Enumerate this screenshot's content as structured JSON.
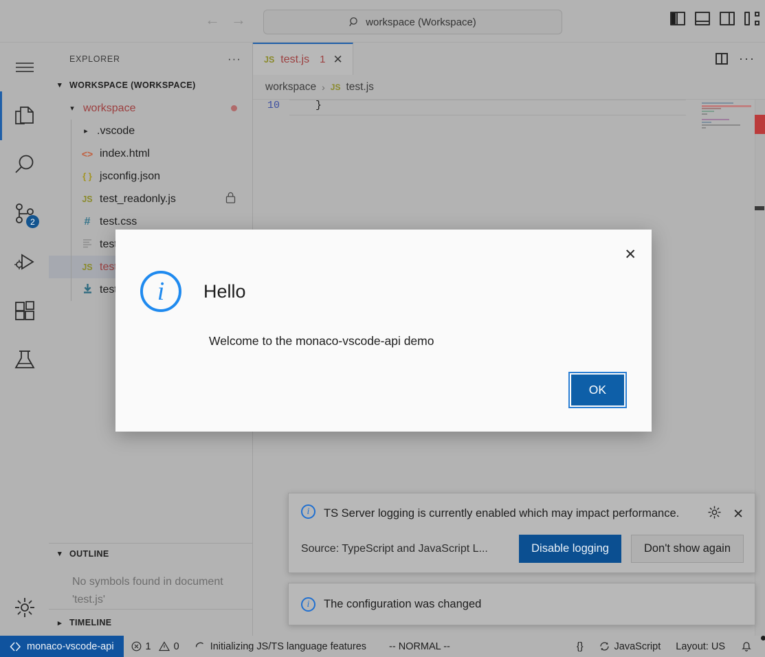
{
  "titlebar": {
    "back_icon": "arrow-left-icon",
    "forward_icon": "arrow-right-icon",
    "search_value": "workspace (Workspace)",
    "search_icon": "search-icon",
    "layout_buttons": [
      {
        "name": "toggle-primary-sidebar",
        "icon": "layout-sidebar-left-icon"
      },
      {
        "name": "toggle-panel",
        "icon": "layout-panel-icon"
      },
      {
        "name": "toggle-secondary-sidebar",
        "icon": "layout-sidebar-right-icon"
      },
      {
        "name": "customize-layout",
        "icon": "layout-customize-icon"
      }
    ]
  },
  "activitybar": {
    "items": [
      {
        "name": "menu",
        "icon": "hamburger-menu-icon",
        "active": false,
        "badge": ""
      },
      {
        "name": "explorer",
        "icon": "files-icon",
        "active": true,
        "badge": ""
      },
      {
        "name": "search",
        "icon": "search-icon",
        "active": false,
        "badge": ""
      },
      {
        "name": "source-control",
        "icon": "source-control-icon",
        "active": false,
        "badge": "2"
      },
      {
        "name": "run-and-debug",
        "icon": "run-debug-icon",
        "active": false,
        "badge": ""
      },
      {
        "name": "extensions",
        "icon": "extensions-icon",
        "active": false,
        "badge": ""
      },
      {
        "name": "testing",
        "icon": "beaker-icon",
        "active": false,
        "badge": ""
      }
    ],
    "settings": {
      "name": "manage-settings",
      "icon": "gear-icon"
    }
  },
  "sidebar": {
    "title": "EXPLORER",
    "more_actions": "···",
    "workspace_section": "WORKSPACE (WORKSPACE)",
    "folder": {
      "label": "workspace",
      "has_dirty_dot": true
    },
    "files": [
      {
        "label": ".vscode",
        "icon": "folder-icon",
        "kind": "folder",
        "selected": false,
        "badge": ""
      },
      {
        "label": "index.html",
        "icon": "html-file-icon",
        "kind": "html",
        "selected": false,
        "badge": ""
      },
      {
        "label": "jsconfig.json",
        "icon": "json-file-icon",
        "kind": "json",
        "selected": false,
        "badge": ""
      },
      {
        "label": "test_readonly.js",
        "icon": "js-file-icon",
        "kind": "js",
        "selected": false,
        "badge": "lock-icon"
      },
      {
        "label": "test.css",
        "icon": "css-file-icon",
        "kind": "css",
        "selected": false,
        "badge": ""
      },
      {
        "label": "test",
        "icon": "text-file-icon",
        "kind": "text",
        "selected": false,
        "badge": ""
      },
      {
        "label": "test",
        "icon": "js-file-icon",
        "kind": "js",
        "selected": true,
        "badge": ""
      },
      {
        "label": "test",
        "icon": "download-file-icon",
        "kind": "other",
        "selected": false,
        "badge": ""
      }
    ],
    "outline": {
      "title": "OUTLINE",
      "empty_message": "No symbols found in document 'test.js'"
    },
    "timeline": {
      "title": "TIMELINE"
    }
  },
  "editor": {
    "tab": {
      "label": "test.js",
      "file_icon": "js-file-icon",
      "problem_count": "1",
      "close_icon": "close-icon"
    },
    "actions": [
      {
        "name": "split-editor",
        "icon": "split-editor-icon"
      },
      {
        "name": "editor-more-actions",
        "icon": "more-actions-icon"
      }
    ],
    "breadcrumb": {
      "root": "workspace",
      "separator": "›",
      "file": "test.js",
      "file_icon": "js-file-icon"
    },
    "code": {
      "line_number": "10",
      "text": "}"
    }
  },
  "notifications": [
    {
      "name": "ts-server-logging",
      "icon": "info-icon",
      "message": "TS Server logging is currently enabled which may impact performance.",
      "source": "Source: TypeScript and JavaScript L...",
      "gear_icon": "gear-icon",
      "close_icon": "close-icon",
      "buttons": [
        {
          "label": "Disable logging",
          "style": "primary"
        },
        {
          "label": "Don't show again",
          "style": "secondary"
        }
      ]
    },
    {
      "name": "configuration-changed",
      "icon": "info-icon",
      "message": "The configuration was changed",
      "source": "",
      "gear_icon": "",
      "close_icon": "",
      "buttons": []
    }
  ],
  "modal": {
    "name": "hello-dialog",
    "icon": "info-icon",
    "title": "Hello",
    "message": "Welcome to the monaco-vscode-api demo",
    "ok_label": "OK",
    "close_icon": "✕"
  },
  "statusbar": {
    "remote": {
      "label": "monaco-vscode-api",
      "icon": "remote-icon"
    },
    "errors": {
      "icon": "error-icon",
      "count": "1"
    },
    "warnings": {
      "icon": "warning-icon",
      "count": "0"
    },
    "task": {
      "icon": "spinner-icon",
      "label": "Initializing JS/TS language features"
    },
    "vim_mode": "-- NORMAL --",
    "braces": "{}",
    "language": {
      "icon": "sync-icon",
      "label": "JavaScript"
    },
    "layout": "Layout: US",
    "bell": {
      "icon": "bell-icon",
      "has_dot": true
    }
  },
  "colors": {
    "background": "#b3b3b3",
    "accent_blue": "#1f5fa8",
    "remote_blue": "#10539e",
    "primary_button": "#0b4f91",
    "modal_button": "#0e5fa8",
    "error_red": "#bb3b3b",
    "active_file_red": "#9c4040",
    "info_blue": "#1f8aef"
  }
}
